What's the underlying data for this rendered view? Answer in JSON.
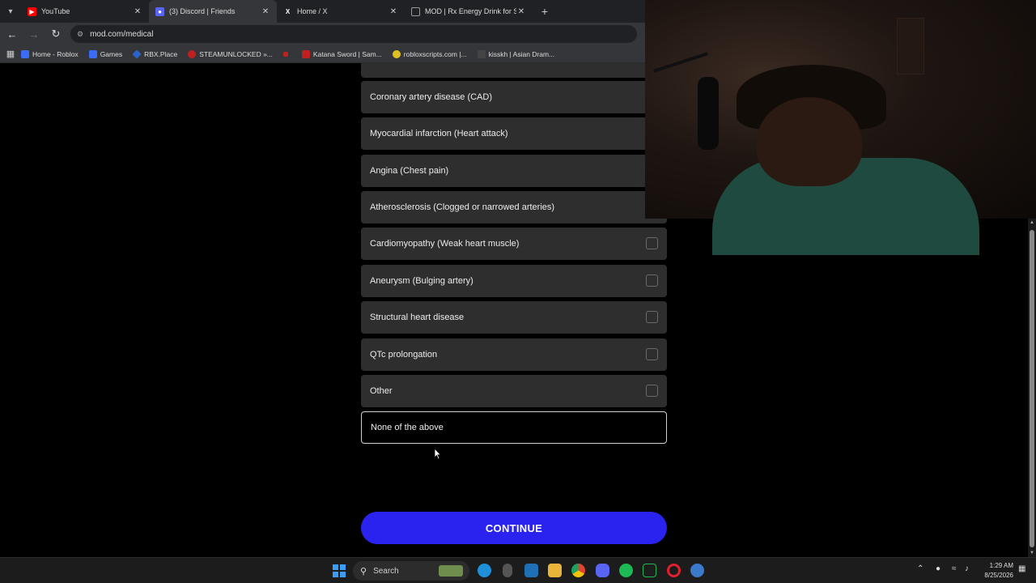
{
  "browser": {
    "tabs": [
      {
        "title": "YouTube",
        "icon": "youtube-icon",
        "color": "#ff0000",
        "active": false
      },
      {
        "title": "(3) Discord | Friends",
        "icon": "discord-icon",
        "color": "#5865f2",
        "active": true
      },
      {
        "title": "Home / X",
        "icon": "x-icon",
        "color": "#000000",
        "active": false
      },
      {
        "title": "MOD | Rx Energy Drink for Sust",
        "icon": "page-icon",
        "color": "#555555",
        "active": false
      }
    ],
    "url": "mod.com/medical",
    "bookmarks": [
      {
        "label": "Home - Roblox",
        "color": "#3b6cf5"
      },
      {
        "label": "Games",
        "color": "#3b6cf5"
      },
      {
        "label": "RBX.Place",
        "color": "#2a62c9"
      },
      {
        "label": "STEAMUNLOCKED »...",
        "color": "#c02020"
      },
      {
        "label": "",
        "color": "#c02020"
      },
      {
        "label": "Katana Sword | Sam...",
        "color": "#c02020"
      },
      {
        "label": "robloxscripts.com |...",
        "color": "#e0c020"
      },
      {
        "label": "kisskh | Asian Dram...",
        "color": "#444444"
      }
    ]
  },
  "main": {
    "options": [
      {
        "label": "",
        "checkbox": false
      },
      {
        "label": "Coronary artery disease (CAD)",
        "checkbox": false
      },
      {
        "label": "Myocardial infarction (Heart attack)",
        "checkbox": false
      },
      {
        "label": "Angina (Chest pain)",
        "checkbox": false
      },
      {
        "label": "Atherosclerosis (Clogged or narrowed arteries)",
        "checkbox": false
      },
      {
        "label": "Cardiomyopathy (Weak heart muscle)",
        "checkbox": true
      },
      {
        "label": "Aneurysm (Bulging artery)",
        "checkbox": true
      },
      {
        "label": "Structural heart disease",
        "checkbox": true
      },
      {
        "label": "QTc prolongation",
        "checkbox": true
      },
      {
        "label": "Other",
        "checkbox": true
      },
      {
        "label": "None of the above",
        "checkbox": false,
        "outlined": true
      }
    ],
    "continue_label": "CONTINUE",
    "accent": "#2a23f0"
  },
  "taskbar": {
    "search_placeholder": "Search",
    "clock_time": "1:29 AM",
    "clock_date": "8/25/2026",
    "apps": [
      {
        "icon": "edge-icon",
        "color": "#1f8fd8"
      },
      {
        "icon": "mouse-icon",
        "color": "#555555"
      },
      {
        "icon": "store-icon",
        "color": "#1f6fb5"
      },
      {
        "icon": "folder-icon",
        "color": "#e8b43a"
      },
      {
        "icon": "chrome-icon",
        "color": "#dd4433"
      },
      {
        "icon": "discord-icon",
        "color": "#5865f2"
      },
      {
        "icon": "spotify-icon",
        "color": "#1db954"
      },
      {
        "icon": "terminal-icon",
        "color": "#1e1e1e"
      },
      {
        "icon": "opera-icon",
        "color": "#e02030"
      },
      {
        "icon": "settings-icon",
        "color": "#3b7ac9"
      }
    ]
  }
}
